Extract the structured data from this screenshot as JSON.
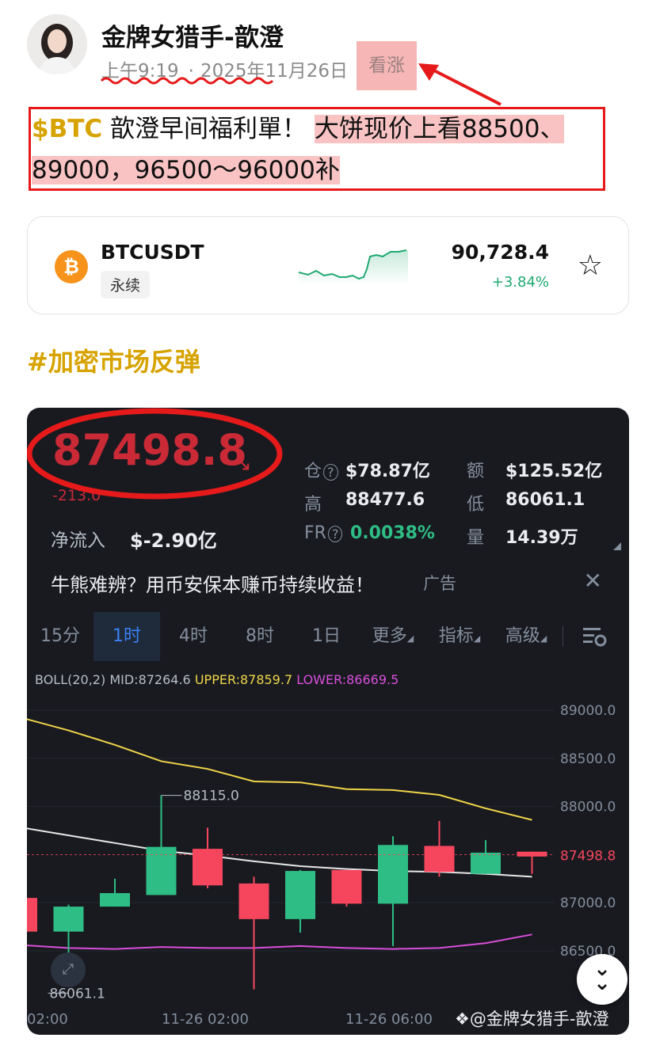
{
  "post": {
    "author": "金牌女猎手-歆澄",
    "time": "上午9:19",
    "date": "2025年11月26日",
    "sentiment": "看涨",
    "cashtag": "$BTC",
    "text_plain": "歆澄早间福利單！",
    "text_highlight_1": "大饼现价上看88500、",
    "text_highlight_2": "89000，96500～96000补",
    "hashtag": "#加密市场反弹"
  },
  "ticker_card": {
    "icon": "bitcoin-icon",
    "pair": "BTCUSDT",
    "contract_type": "永续",
    "price": "90,728.4",
    "change_pct": "+3.84%",
    "favorite_icon": "star-icon"
  },
  "market": {
    "last_price": "87498.8",
    "change_partial": "-213.0",
    "stats": {
      "open_interest_label": "仓",
      "open_interest": "$78.87亿",
      "turnover_label": "额",
      "turnover": "$125.52亿",
      "high_label": "高",
      "high": "88477.6",
      "low_label": "低",
      "low": "86061.1",
      "fr_label": "FR",
      "funding_rate": "0.0038%",
      "volume_label": "量",
      "volume": "14.39万",
      "net_inflow_label": "净流入",
      "net_inflow": "$-2.90亿"
    },
    "ad": {
      "text": "牛熊难辨？用币安保本赚币持续收益！",
      "tag": "广告"
    },
    "tabs": [
      "15分",
      "1时",
      "4时",
      "8时",
      "1日",
      "更多",
      "指标",
      "高级"
    ],
    "active_tab": "1时",
    "indicator": {
      "name": "BOLL(20,2)",
      "mid": "MID:87264.6",
      "upper": "UPPER:87859.7",
      "lower": "LOWER:86669.5"
    },
    "time_labels": [
      "02:00",
      "11-26 02:00",
      "11-26 06:00"
    ],
    "watermark": "@金牌女猎手-歆澄",
    "colors": {
      "up": "#2ebd85",
      "down": "#f6465d",
      "upper_band": "#f0d548",
      "lower_band": "#d94ed9",
      "mid_band": "#e8e8e8"
    }
  },
  "chart_data": {
    "type": "candlestick",
    "interval": "1时",
    "y_ticks": [
      "89000.0",
      "88500.0",
      "88000.0",
      "87000.0",
      "86500.0"
    ],
    "ylim": [
      86000,
      89000
    ],
    "current_price_label": "87498.8",
    "high_marker": "88115.0",
    "low_marker": "86061.1",
    "candles": [
      {
        "open": 87050,
        "high": 87050,
        "low": 86600,
        "close": 86700
      },
      {
        "open": 86700,
        "high": 86980,
        "low": 86150,
        "close": 86960
      },
      {
        "open": 86960,
        "high": 87250,
        "low": 86960,
        "close": 87100
      },
      {
        "open": 87080,
        "high": 88115,
        "low": 87080,
        "close": 87580
      },
      {
        "open": 87560,
        "high": 87780,
        "low": 87150,
        "close": 87180
      },
      {
        "open": 87200,
        "high": 87270,
        "low": 86100,
        "close": 86830
      },
      {
        "open": 86830,
        "high": 87340,
        "low": 86690,
        "close": 87330
      },
      {
        "open": 87340,
        "high": 87340,
        "low": 86960,
        "close": 86990
      },
      {
        "open": 86990,
        "high": 87690,
        "low": 86550,
        "close": 87600
      },
      {
        "open": 87590,
        "high": 87850,
        "low": 87270,
        "close": 87320
      },
      {
        "open": 87300,
        "high": 87650,
        "low": 87300,
        "close": 87520
      },
      {
        "open": 87530,
        "high": 87530,
        "low": 87300,
        "close": 87480
      }
    ],
    "upper_band": [
      88920,
      88790,
      88640,
      88470,
      88390,
      88260,
      88250,
      88180,
      88170,
      88120,
      87980,
      87860
    ],
    "mid_band": [
      87780,
      87700,
      87620,
      87540,
      87490,
      87430,
      87380,
      87350,
      87330,
      87320,
      87300,
      87270
    ],
    "lower_band": [
      86560,
      86530,
      86520,
      86540,
      86530,
      86530,
      86550,
      86530,
      86520,
      86530,
      86580,
      86670
    ]
  }
}
